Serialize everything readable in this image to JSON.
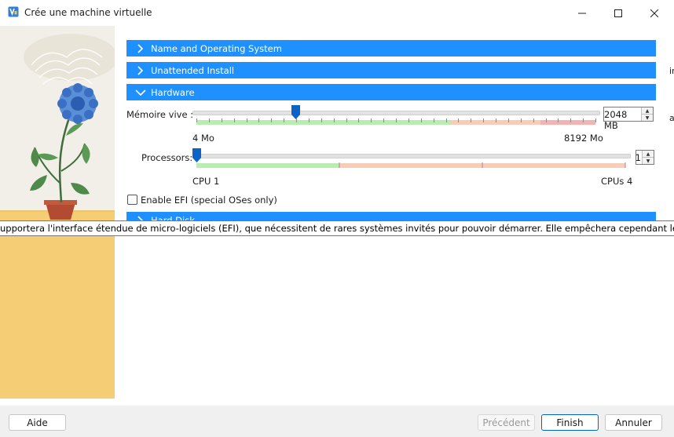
{
  "window": {
    "title": "Crée une machine virtuelle"
  },
  "sections": {
    "name_os": "Name and Operating System",
    "unattended": "Unattended Install",
    "hardware": "Hardware",
    "hard_disk": "Hard Disk"
  },
  "memory": {
    "label": "Mémoire vive :",
    "value": "2048 MB",
    "min_label": "4 Mo",
    "max_label": "8192 Mo",
    "min_mb": 4,
    "max_mb": 8192,
    "current_mb": 2048
  },
  "processors": {
    "label": "Processors:",
    "value": "1",
    "min_label": "CPU 1",
    "max_label": "CPUs 4",
    "min": 1,
    "max": 4,
    "current": 1
  },
  "efi": {
    "label": "Enable EFI (special OSes only)",
    "checked": false
  },
  "tooltip": "upportera l'interface étendue de micro-logiciels (EFI), que nécessitent de rares systèmes invités pour pouvoir démarrer. Elle empêchera cependant les invités qui ne l",
  "side_fragments": [
    "ir",
    "a"
  ],
  "buttons": {
    "help": "Aide",
    "back": "Précédent",
    "finish": "Finish",
    "cancel": "Annuler"
  },
  "icons": {
    "app": "virtualbox-icon",
    "minimize": "minimize-icon",
    "maximize": "maximize-icon",
    "close": "close-icon"
  },
  "colors": {
    "section_bg": "#1e90ff",
    "slider_green": "#b9ecb1",
    "slider_orange": "#f7cdb8",
    "slider_red": "#f2b3b3",
    "thumb": "#0a64c8"
  }
}
